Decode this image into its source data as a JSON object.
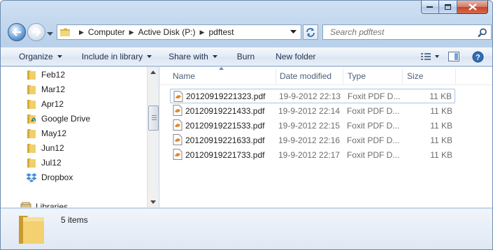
{
  "address": {
    "crumbs": [
      "Computer",
      "Active Disk (P:)",
      "pdftest"
    ]
  },
  "search": {
    "placeholder": "Search pdftest"
  },
  "toolbar": {
    "organize": "Organize",
    "include_in_library": "Include in library",
    "share_with": "Share with",
    "burn": "Burn",
    "new_folder": "New folder"
  },
  "nav_pane": {
    "items": [
      {
        "label": "Feb12",
        "icon": "folder-icon"
      },
      {
        "label": "Mar12",
        "icon": "folder-icon"
      },
      {
        "label": "Apr12",
        "icon": "folder-icon"
      },
      {
        "label": "Google Drive",
        "icon": "google-drive-icon"
      },
      {
        "label": "May12",
        "icon": "folder-icon"
      },
      {
        "label": "Jun12",
        "icon": "folder-icon"
      },
      {
        "label": "Jul12",
        "icon": "folder-icon"
      },
      {
        "label": "Dropbox",
        "icon": "dropbox-icon"
      },
      {
        "label": "Libraries",
        "icon": "libraries-icon"
      }
    ]
  },
  "columns": {
    "name": "Name",
    "date_modified": "Date modified",
    "type": "Type",
    "size": "Size"
  },
  "files": [
    {
      "name": "20120919221323.pdf",
      "date": "19-9-2012 22:13",
      "type": "Foxit PDF D...",
      "size": "11 KB"
    },
    {
      "name": "20120919221433.pdf",
      "date": "19-9-2012 22:14",
      "type": "Foxit PDF D...",
      "size": "11 KB"
    },
    {
      "name": "20120919221533.pdf",
      "date": "19-9-2012 22:15",
      "type": "Foxit PDF D...",
      "size": "11 KB"
    },
    {
      "name": "20120919221633.pdf",
      "date": "19-9-2012 22:16",
      "type": "Foxit PDF D...",
      "size": "11 KB"
    },
    {
      "name": "20120919221733.pdf",
      "date": "19-9-2012 22:17",
      "type": "Foxit PDF D...",
      "size": "11 KB"
    }
  ],
  "details": {
    "item_count": "5 items"
  },
  "colors": {
    "link_text": "#1e3150",
    "header_text": "#4c607a",
    "focus_border": "#a8c4e4",
    "close_button": "#c4452c"
  }
}
